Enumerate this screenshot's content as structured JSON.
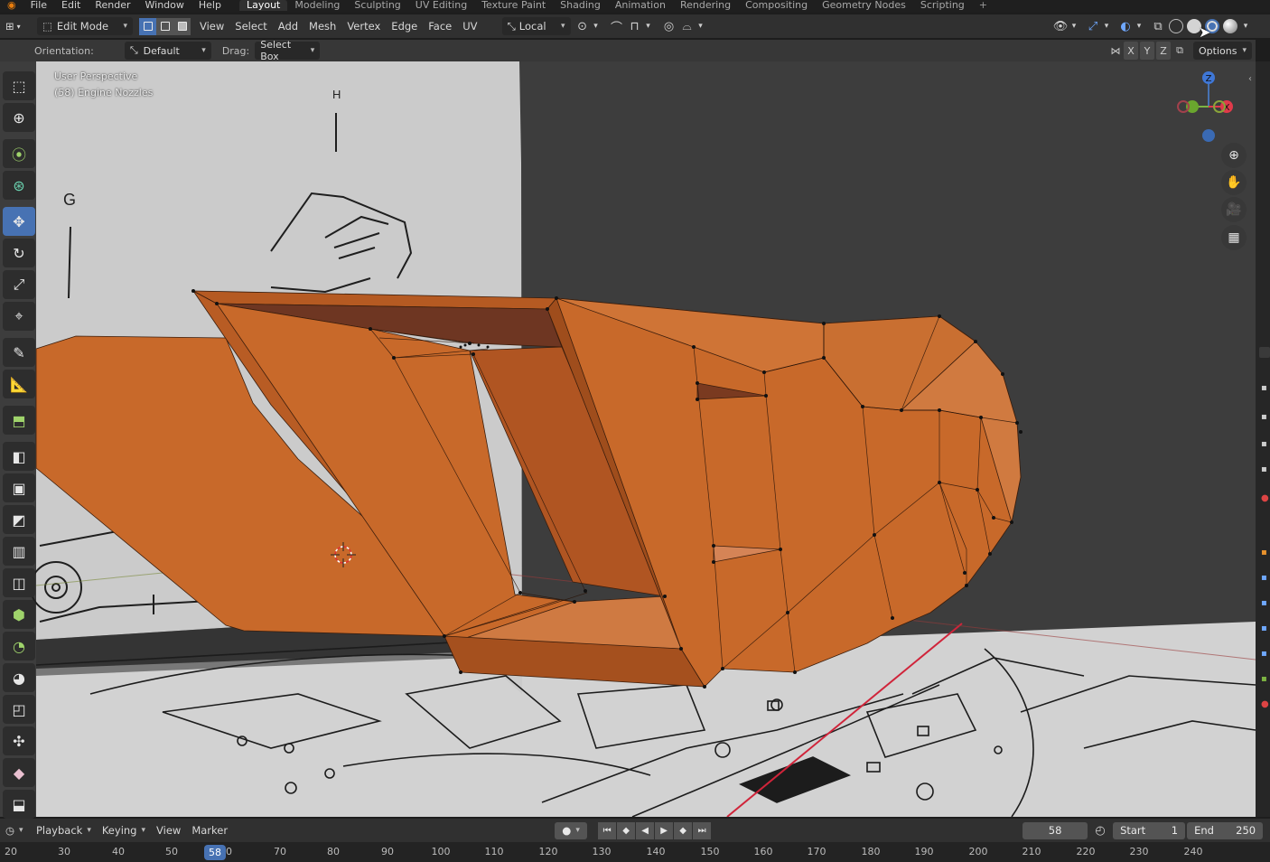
{
  "menu": {
    "items": [
      "File",
      "Edit",
      "Render",
      "Window",
      "Help"
    ],
    "workspaces": [
      "Layout",
      "Modeling",
      "Sculpting",
      "UV Editing",
      "Texture Paint",
      "Shading",
      "Animation",
      "Rendering",
      "Compositing",
      "Geometry Nodes",
      "Scripting"
    ],
    "active_workspace": "Layout",
    "add_tab": "+"
  },
  "header": {
    "mode": "Edit Mode",
    "menus": [
      "View",
      "Select",
      "Add",
      "Mesh",
      "Vertex",
      "Edge",
      "Face",
      "UV"
    ],
    "transform_orientation": "Local"
  },
  "tool_settings": {
    "orientation_label": "Orientation:",
    "orientation_value": "Default",
    "drag_label": "Drag:",
    "drag_value": "Select Box",
    "axes": [
      "X",
      "Y",
      "Z"
    ],
    "options": "Options"
  },
  "viewport": {
    "view_name": "User Perspective",
    "object_info": "(58) Engine Nozzles",
    "gizmo_axes": [
      "Z",
      "Y",
      "X"
    ],
    "blueprint_letters": [
      "H",
      "G"
    ],
    "colors": {
      "background": "#3d3d3d",
      "mesh_face": "#c8692a",
      "mesh_dark": "#a85220",
      "mesh_shadow": "#6e3622",
      "blueprint_bg": "#d4d4d4",
      "x_axis": "#d0243a",
      "accent_blue": "#4772b3"
    }
  },
  "toolbar": {
    "tools": [
      "select-box-icon",
      "cursor-icon",
      "tweak-icon",
      "select-circle-icon",
      "move-icon",
      "rotate-icon",
      "scale-icon",
      "transform-icon",
      "annotate-icon",
      "measure-icon",
      "add-cube-icon",
      "extrude-icon",
      "inset-icon",
      "bevel-icon",
      "loop-cut-icon",
      "knife-icon",
      "poly-build-icon",
      "spin-icon",
      "smooth-icon",
      "edge-slide-icon",
      "shrink-fatten-icon",
      "shear-icon",
      "rip-icon"
    ],
    "active_tool": "move-icon"
  },
  "timeline": {
    "playback": "Playback",
    "keying": "Keying",
    "view": "View",
    "marker": "Marker",
    "current_frame": "58",
    "start_label": "Start",
    "start_value": "1",
    "end_label": "End",
    "end_value": "250",
    "ruler_ticks": [
      "20",
      "30",
      "40",
      "50",
      "60",
      "70",
      "80",
      "90",
      "100",
      "110",
      "120",
      "130",
      "140",
      "150",
      "160",
      "170",
      "180",
      "190",
      "200",
      "210",
      "220",
      "230",
      "240"
    ]
  }
}
